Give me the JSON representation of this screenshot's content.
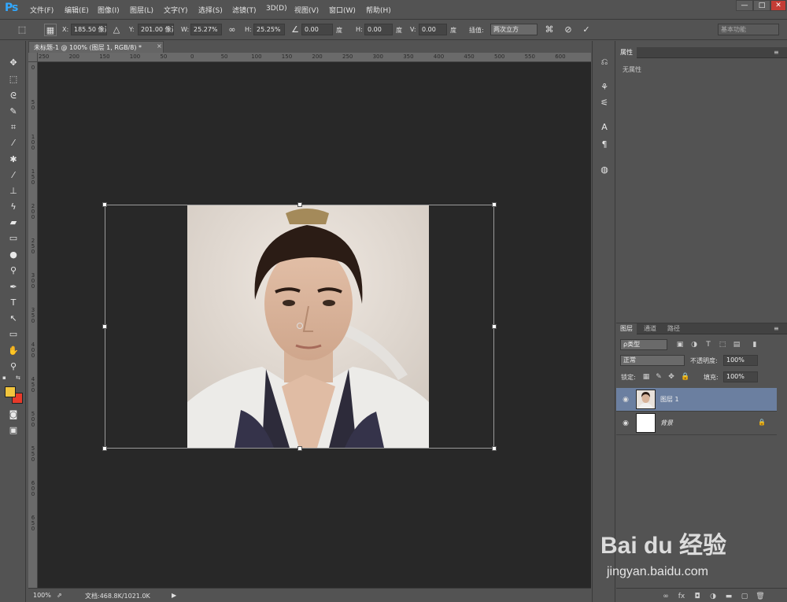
{
  "app": {
    "logo": "Ps"
  },
  "menu": [
    "文件(F)",
    "编辑(E)",
    "图像(I)",
    "图层(L)",
    "文字(Y)",
    "选择(S)",
    "滤镜(T)",
    "3D(D)",
    "视图(V)",
    "窗口(W)",
    "帮助(H)"
  ],
  "window_controls": {
    "minimize": "—",
    "maximize": "□",
    "close": "✕"
  },
  "options": {
    "x_label": "X:",
    "x_value": "185.50 像素",
    "y_label": "Y:",
    "y_value": "201.00 像素",
    "w_label": "W:",
    "w_value": "25.27%",
    "h_label": "H:",
    "h_value": "25.25%",
    "angle_value": "0.00",
    "angle_unit": "度",
    "hskew_label": "H:",
    "hskew_value": "0.00",
    "hskew_unit": "度",
    "vskew_label": "V:",
    "vskew_value": "0.00",
    "vskew_unit": "度",
    "interp_label": "插值:",
    "interp_value": "两次立方",
    "workspace": "基本功能"
  },
  "document": {
    "tab_title": "未标题-1 @ 100% (图层 1, RGB/8) *",
    "ruler_top": [
      "250",
      "200",
      "150",
      "100",
      "50",
      "0",
      "50",
      "100",
      "150",
      "200",
      "250",
      "300",
      "350",
      "400",
      "450",
      "500",
      "550",
      "600"
    ],
    "ruler_left": [
      "0",
      "5 0",
      "1 0 0",
      "1 5 0",
      "2 0 0",
      "2 5 0",
      "3 0 0",
      "3 5 0",
      "4 0 0",
      "4 5 0",
      "5 0 0",
      "5 5 0",
      "6 0 0",
      "6 5 0"
    ]
  },
  "status": {
    "zoom": "100%",
    "doc_info": "文档:468.8K/1021.0K"
  },
  "properties": {
    "tab": "属性",
    "empty_text": "无属性"
  },
  "layers": {
    "tabs": [
      "图层",
      "通道",
      "路径"
    ],
    "filter_kind": "ρ类型",
    "blend_mode": "正常",
    "opacity_label": "不透明度:",
    "opacity_value": "100%",
    "lock_label": "锁定:",
    "fill_label": "填充:",
    "fill_value": "100%",
    "items": [
      {
        "name": "图层 1",
        "selected": true
      },
      {
        "name": "背景",
        "locked": true
      }
    ]
  },
  "watermark": {
    "logo": "Bai du 经验",
    "url": "jingyan.baidu.com"
  },
  "colors": {
    "foreground": "#f2c53d",
    "background": "#e83a2a",
    "selected_layer": "#6b7fa0"
  }
}
